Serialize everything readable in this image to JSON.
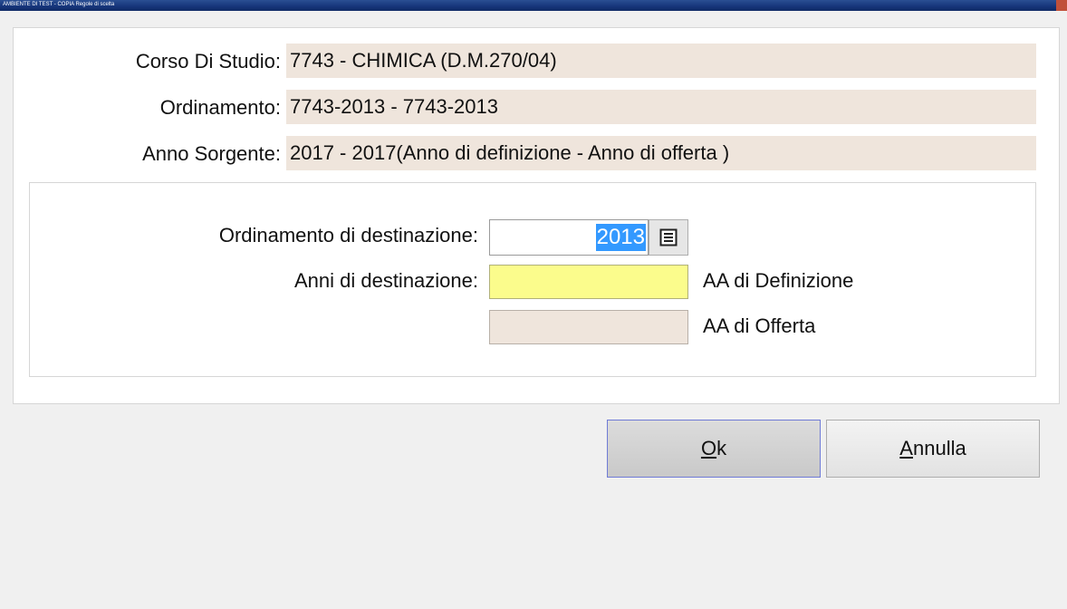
{
  "window": {
    "title": "AMBIENTE DI TEST - COPIA Regole di scelta"
  },
  "info": {
    "corso": {
      "label": "Corso Di Studio:",
      "value": "7743 - CHIMICA (D.M.270/04)"
    },
    "ordinamento": {
      "label": "Ordinamento:",
      "value": "7743-2013 - 7743-2013"
    },
    "anno_sorgente": {
      "label": "Anno Sorgente:",
      "value": "2017 - 2017(Anno di definizione - Anno di offerta )"
    }
  },
  "form": {
    "ordinamento_dest": {
      "label": "Ordinamento di destinazione:",
      "value": "2013"
    },
    "anni_dest": {
      "label": "Anni di destinazione:",
      "value": "",
      "suffix": "AA di Definizione"
    },
    "aa_offerta": {
      "value": "",
      "suffix": "AA di Offerta"
    }
  },
  "buttons": {
    "ok": {
      "mnemonic": "O",
      "rest": "k"
    },
    "cancel": {
      "mnemonic": "A",
      "rest": "nnulla"
    }
  },
  "colors": {
    "readonly_bg": "#efe5dc",
    "required_bg": "#fbfc8c",
    "selection_bg": "#3399ff",
    "titlebar_bg": "#16357a"
  }
}
